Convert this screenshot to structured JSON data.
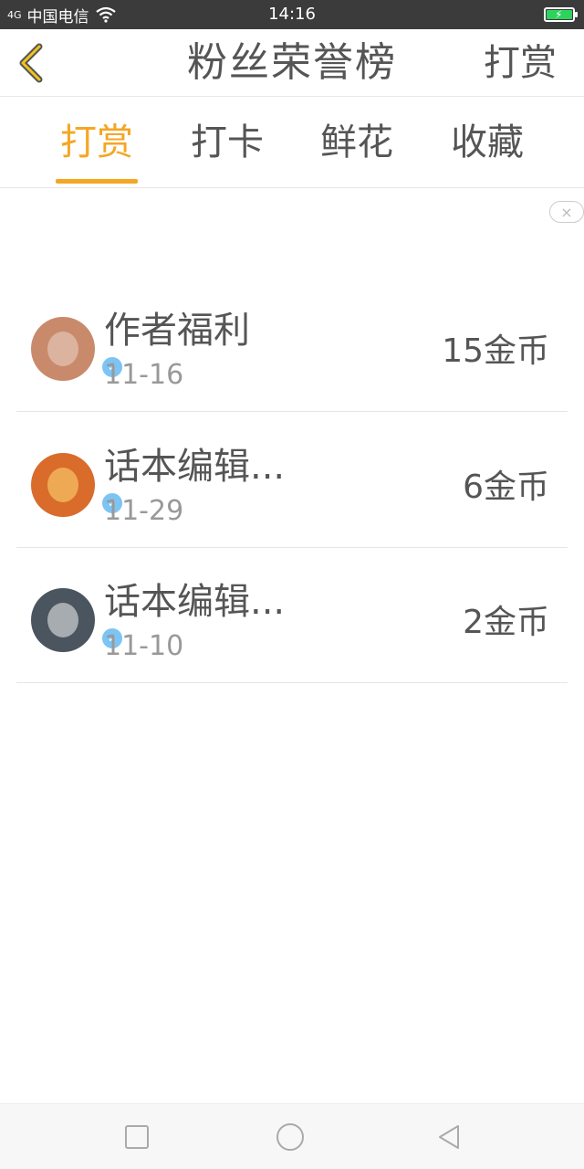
{
  "status_bar": {
    "network": "4G",
    "carrier": "中国电信",
    "time": "14:16"
  },
  "header": {
    "title": "粉丝荣誉榜",
    "right_action": "打赏"
  },
  "tabs": [
    {
      "label": "打赏",
      "active": true
    },
    {
      "label": "打卡",
      "active": false
    },
    {
      "label": "鲜花",
      "active": false
    },
    {
      "label": "收藏",
      "active": false
    }
  ],
  "ad_close": "×",
  "entries": [
    {
      "name": "作者福利",
      "date": "11-16",
      "amount": "15金币",
      "avatar_color": "#c98a6b"
    },
    {
      "name": "话本编辑...",
      "date": "11-29",
      "amount": "6金币",
      "avatar_color": "#d96b2b"
    },
    {
      "name": "话本编辑...",
      "date": "11-10",
      "amount": "2金币",
      "avatar_color": "#4a5560"
    }
  ],
  "accent_color": "#f5a623"
}
